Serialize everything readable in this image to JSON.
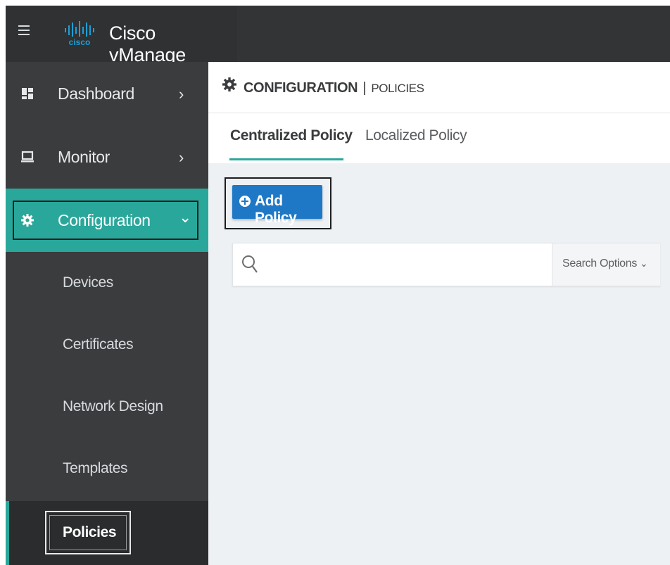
{
  "app": {
    "brand": "cisco",
    "title": "Cisco vManage"
  },
  "sidebar": {
    "items": [
      {
        "label": "Dashboard",
        "icon": "dashboard-icon",
        "chevron": "›"
      },
      {
        "label": "Monitor",
        "icon": "monitor-icon",
        "chevron": "›"
      },
      {
        "label": "Configuration",
        "icon": "gear-icon",
        "chevron": "⌄"
      }
    ],
    "sub_items": [
      {
        "label": "Devices"
      },
      {
        "label": "Certificates"
      },
      {
        "label": "Network Design"
      },
      {
        "label": "Templates"
      },
      {
        "label": "Policies"
      }
    ]
  },
  "header": {
    "section": "CONFIGURATION",
    "separator": "|",
    "page": "POLICIES"
  },
  "tabs": [
    {
      "label": "Centralized Policy",
      "active": true
    },
    {
      "label": "Localized Policy",
      "active": false
    }
  ],
  "actions": {
    "add_policy_label": "Add Policy"
  },
  "search": {
    "placeholder": "",
    "value": "",
    "options_label": "Search Options",
    "options_chevron": "⌄"
  },
  "colors": {
    "accent": "#2aa79b",
    "primary_button": "#1f78c5",
    "sidebar_bg": "#3a3c3e",
    "topbar_bg": "#323436",
    "content_bg": "#eef1f4"
  }
}
